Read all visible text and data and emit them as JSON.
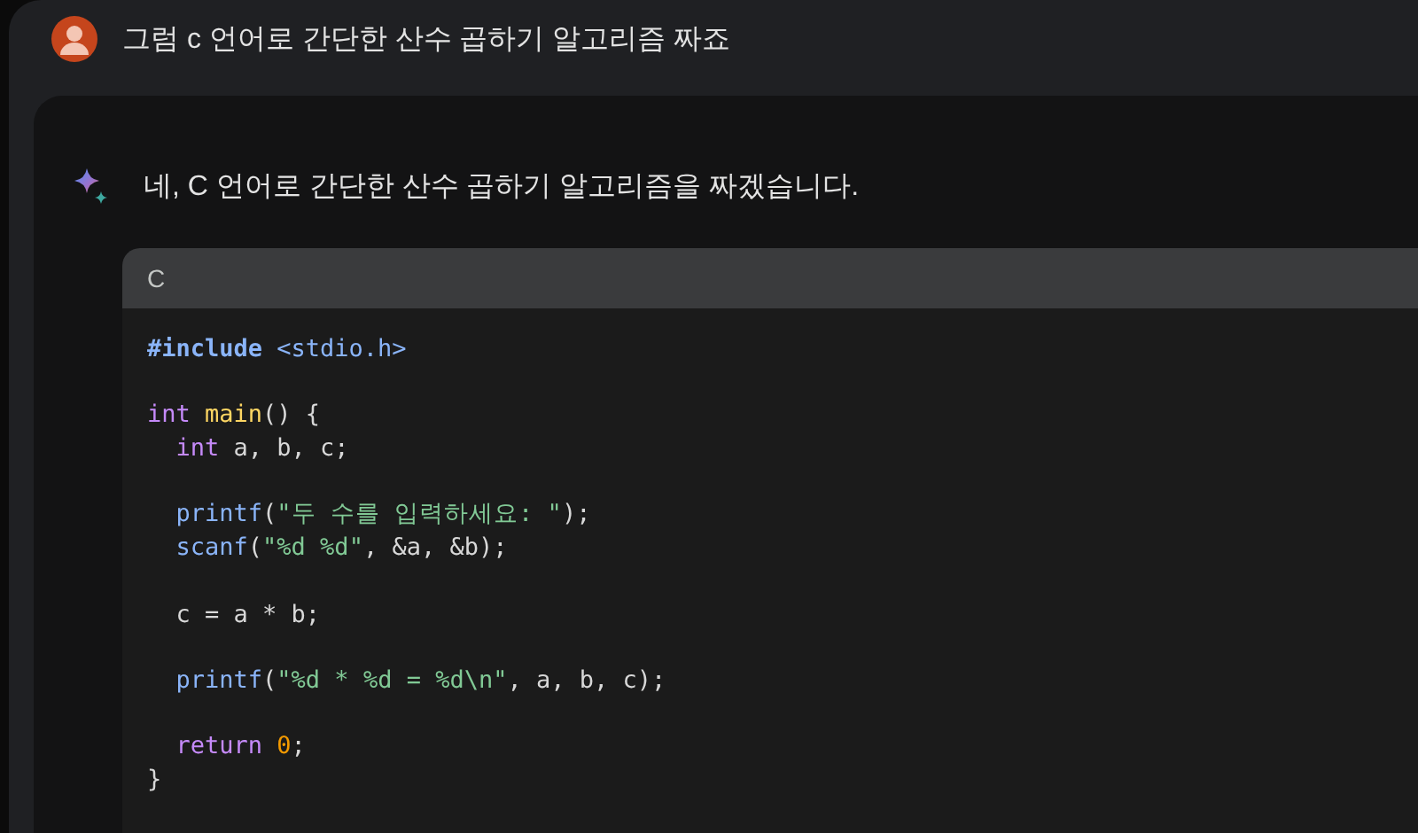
{
  "prompt": {
    "text": "그럼 c 언어로 간단한 산수 곱하기 알고리즘 짜죠"
  },
  "response": {
    "text": "네, C 언어로 간단한 산수 곱하기 알고리즘을 짜겠습니다.",
    "code": {
      "language": "C",
      "blocks": [
        [
          [
            {
              "kind": "directive",
              "text": "#include"
            },
            {
              "kind": "header",
              "text": " <stdio.h>"
            }
          ]
        ],
        [
          [
            {
              "kind": "keyword",
              "text": "int"
            },
            {
              "kind": "function",
              "text": " main"
            },
            {
              "kind": "plain",
              "text": "() {"
            }
          ],
          [
            {
              "kind": "keyword",
              "text": "  int"
            },
            {
              "kind": "plain",
              "text": " a, b, c;"
            }
          ]
        ],
        [
          [
            {
              "kind": "call",
              "text": "  printf"
            },
            {
              "kind": "plain",
              "text": "("
            },
            {
              "kind": "string",
              "text": "\"두 수를 입력하세요: \""
            },
            {
              "kind": "plain",
              "text": ");"
            }
          ],
          [
            {
              "kind": "call",
              "text": "  scanf"
            },
            {
              "kind": "plain",
              "text": "("
            },
            {
              "kind": "string",
              "text": "\"%d %d\""
            },
            {
              "kind": "plain",
              "text": ", &a, &b);"
            }
          ]
        ],
        [
          [
            {
              "kind": "plain",
              "text": "  c = a * b;"
            }
          ]
        ],
        [
          [
            {
              "kind": "call",
              "text": "  printf"
            },
            {
              "kind": "plain",
              "text": "("
            },
            {
              "kind": "string",
              "text": "\"%d * %d = %d\\n\""
            },
            {
              "kind": "plain",
              "text": ", a, b, c);"
            }
          ]
        ],
        [
          [
            {
              "kind": "keyword",
              "text": "  return"
            },
            {
              "kind": "number",
              "text": " 0"
            },
            {
              "kind": "plain",
              "text": ";"
            }
          ],
          [
            {
              "kind": "plain",
              "text": "}"
            }
          ]
        ]
      ]
    }
  }
}
